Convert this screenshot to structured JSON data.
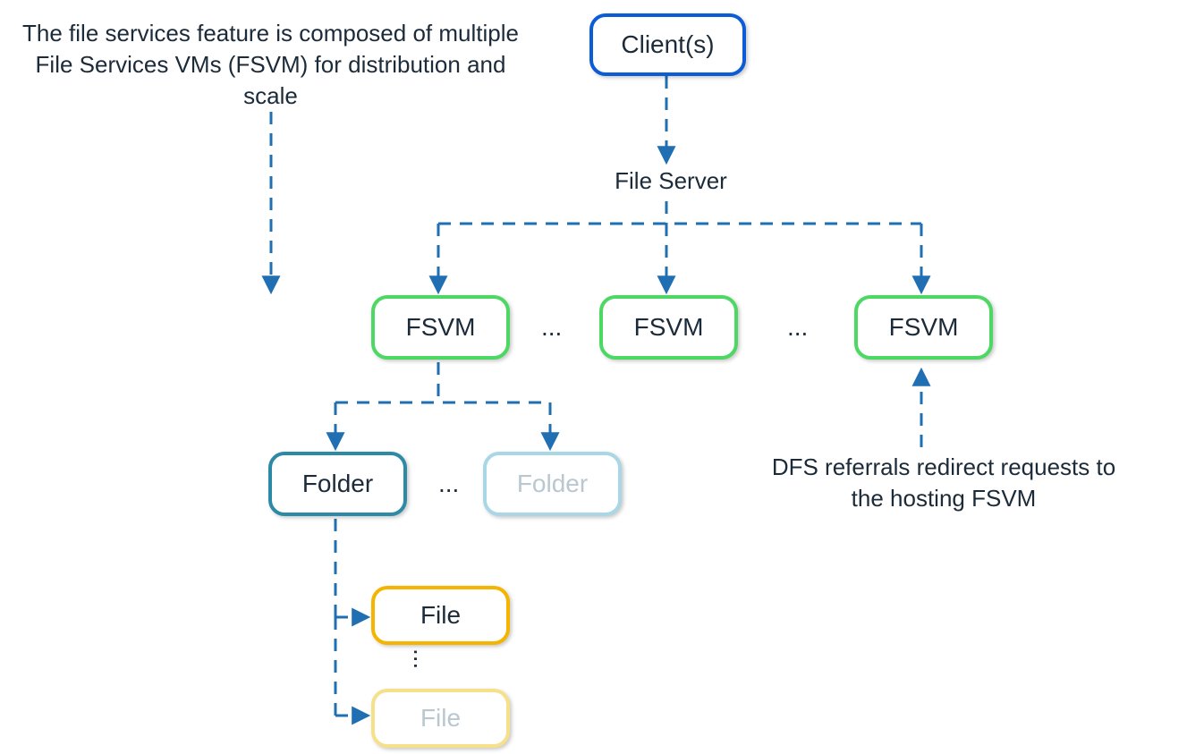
{
  "annotations": {
    "left_note": "The file services feature is composed of multiple File Services VMs (FSVM) for distribution and scale",
    "right_note": "DFS referrals redirect requests to the hosting FSVM",
    "file_server_label": "File Server"
  },
  "nodes": {
    "client": "Client(s)",
    "fsvm1": "FSVM",
    "fsvm2": "FSVM",
    "fsvm3": "FSVM",
    "folder1": "Folder",
    "folder2": "Folder",
    "file1": "File",
    "file2": "File"
  },
  "ellipsis": "...",
  "colors": {
    "blue": "#0b5cd6",
    "green": "#4cd863",
    "teal": "#2d8aa6",
    "teal_light": "#a9d7e5",
    "gold": "#f5b400",
    "gold_light": "#f7e08a",
    "dash": "#1f6fb2"
  }
}
